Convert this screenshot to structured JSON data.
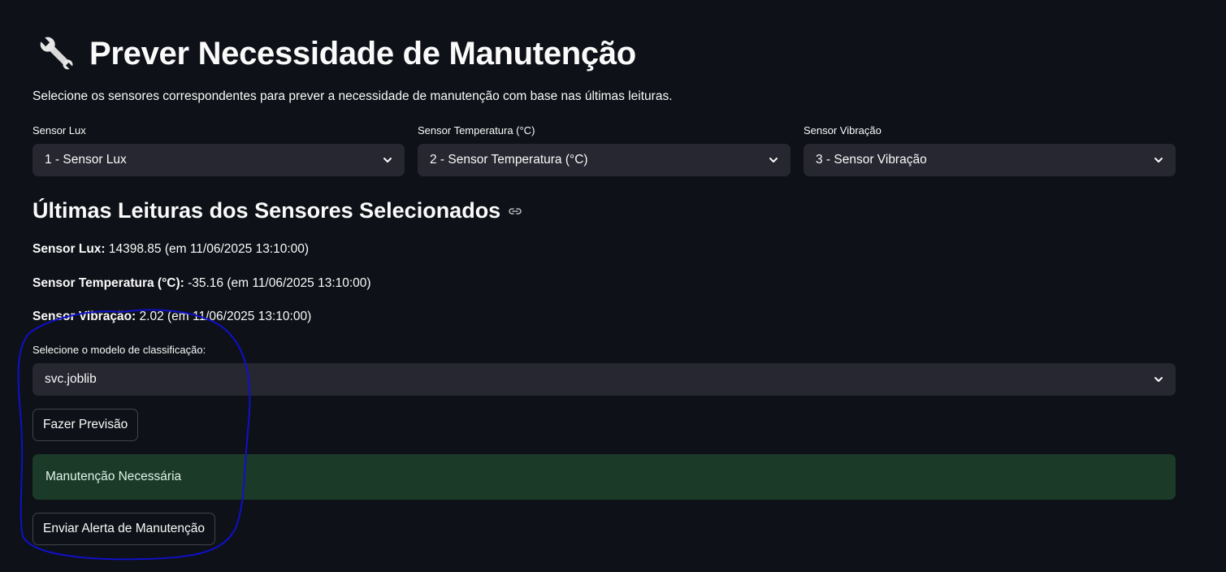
{
  "header": {
    "title": "Prever Necessidade de Manutenção",
    "title_icon": "wrench-icon",
    "subtitle": "Selecione os sensores correspondentes para prever a necessidade de manutenção com base nas últimas leituras."
  },
  "sensors": {
    "lux": {
      "label": "Sensor Lux",
      "value": "1 - Sensor Lux"
    },
    "temp": {
      "label": "Sensor Temperatura (°C)",
      "value": "2 - Sensor Temperatura (°C)"
    },
    "vib": {
      "label": "Sensor Vibração",
      "value": "3 - Sensor Vibração"
    }
  },
  "readings": {
    "heading": "Últimas Leituras dos Sensores Selecionados",
    "items": [
      {
        "name": "Sensor Lux:",
        "text": " 14398.85 (em 11/06/2025 13:10:00)"
      },
      {
        "name": "Sensor Temperatura (°C):",
        "text": " -35.16 (em 11/06/2025 13:10:00)"
      },
      {
        "name": "Sensor Vibração:",
        "text": " 2.02 (em 11/06/2025 13:10:00)"
      }
    ]
  },
  "model": {
    "label": "Selecione o modelo de classificação:",
    "value": "svc.joblib"
  },
  "actions": {
    "predict_label": "Fazer Previsão",
    "alert_label": "Enviar Alerta de Manutenção"
  },
  "result": {
    "message": "Manutenção Necessária"
  },
  "colors": {
    "background": "#0e1117",
    "select_bg": "#262730",
    "success_bg": "#1b3a28",
    "annotation": "#1010c8"
  }
}
